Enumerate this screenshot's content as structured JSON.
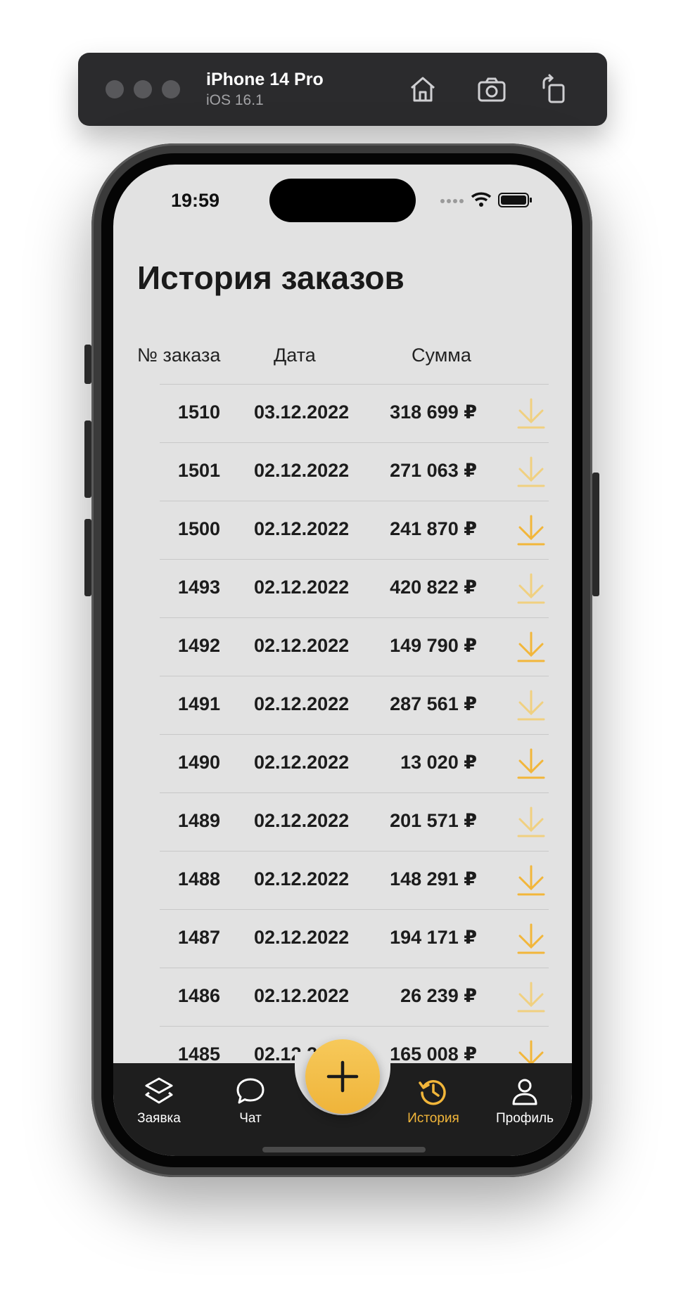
{
  "simulator": {
    "device": "iPhone 14 Pro",
    "os": "iOS 16.1",
    "icons": [
      "home-icon",
      "screenshot-icon",
      "rotate-icon"
    ]
  },
  "status_bar": {
    "time": "19:59"
  },
  "page": {
    "title": "История заказов",
    "columns": {
      "order_no": "№ заказа",
      "date": "Дата",
      "sum": "Сумма"
    }
  },
  "orders": [
    {
      "id": "1510",
      "date": "03.12.2022",
      "sum": "318 699 ₽",
      "download_active": false
    },
    {
      "id": "1501",
      "date": "02.12.2022",
      "sum": "271 063 ₽",
      "download_active": false
    },
    {
      "id": "1500",
      "date": "02.12.2022",
      "sum": "241 870 ₽",
      "download_active": true
    },
    {
      "id": "1493",
      "date": "02.12.2022",
      "sum": "420 822 ₽",
      "download_active": false
    },
    {
      "id": "1492",
      "date": "02.12.2022",
      "sum": "149 790 ₽",
      "download_active": true
    },
    {
      "id": "1491",
      "date": "02.12.2022",
      "sum": "287 561 ₽",
      "download_active": false
    },
    {
      "id": "1490",
      "date": "02.12.2022",
      "sum": "13 020 ₽",
      "download_active": true
    },
    {
      "id": "1489",
      "date": "02.12.2022",
      "sum": "201 571 ₽",
      "download_active": false
    },
    {
      "id": "1488",
      "date": "02.12.2022",
      "sum": "148 291 ₽",
      "download_active": true
    },
    {
      "id": "1487",
      "date": "02.12.2022",
      "sum": "194 171 ₽",
      "download_active": true
    },
    {
      "id": "1486",
      "date": "02.12.2022",
      "sum": "26 239 ₽",
      "download_active": false
    },
    {
      "id": "1485",
      "date": "02.12.2022",
      "sum": "165 008 ₽",
      "download_active": true
    }
  ],
  "tabbar": {
    "items": [
      {
        "label": "Заявка",
        "icon": "layers-icon",
        "active": false
      },
      {
        "label": "Чат",
        "icon": "chat-bubble-icon",
        "active": false
      },
      {
        "label": "История",
        "icon": "history-icon",
        "active": true
      },
      {
        "label": "Профиль",
        "icon": "user-icon",
        "active": false
      }
    ],
    "fab_icon": "plus-icon"
  },
  "colors": {
    "accent": "#f2b63a",
    "accent_muted": "#f0d080",
    "screen_bg": "#e2e2e2",
    "tabbar_bg": "#1e1e1e",
    "text": "#1c1c1c"
  }
}
